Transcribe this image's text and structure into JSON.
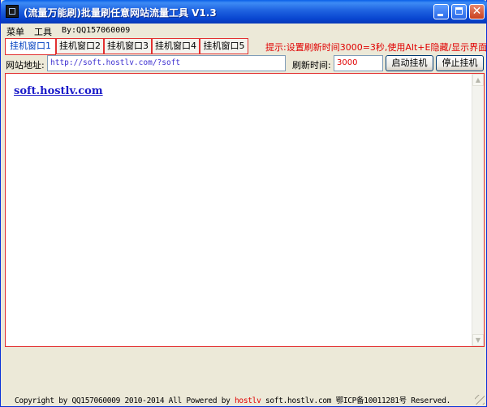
{
  "window": {
    "title": "(流量万能刷)批量刷任意网站流量工具 V1.3",
    "buttons": {
      "minimize": "minimize",
      "maximize": "maximize",
      "close": "✕"
    }
  },
  "menubar": {
    "menu_label": "菜单",
    "tools_label": "工具",
    "by_label": "By:QQ157060009"
  },
  "tabs": [
    {
      "label": "挂机窗口1",
      "active": true
    },
    {
      "label": "挂机窗口2",
      "active": false
    },
    {
      "label": "挂机窗口3",
      "active": false
    },
    {
      "label": "挂机窗口4",
      "active": false
    },
    {
      "label": "挂机窗口5",
      "active": false
    }
  ],
  "hint": "提示:设置刷新时间3000=3秒,使用Alt+E隐藏/显示界面",
  "address": {
    "label": "网站地址:",
    "url": "http://soft.hostlv.com/?soft",
    "refresh_label": "刷新时间:",
    "refresh_value": "3000",
    "start_button": "启动挂机",
    "stop_button": "停止挂机"
  },
  "browser": {
    "link_text": "soft.hostlv.com"
  },
  "status": {
    "prefix": "Copyright by QQ157060009 2010-2014 All Powered by ",
    "brand": "hostlv",
    "suffix": " soft.hostlv.com 鄂ICP备10011281号 Reserved."
  },
  "colors": {
    "accent_red": "#E23030",
    "hint_red": "#E00000",
    "link_blue": "#1A1AC8",
    "titlebar_blue": "#0845D0"
  }
}
